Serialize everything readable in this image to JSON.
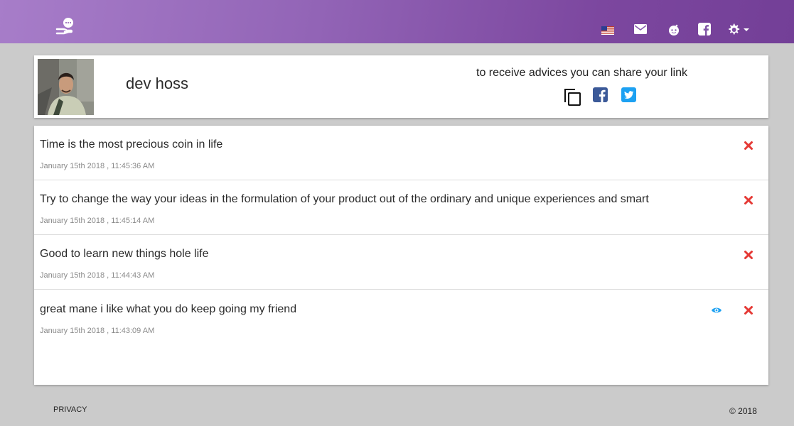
{
  "nav": {
    "icons": [
      "hand-chat-logo-icon",
      "us-flag-icon",
      "mail-icon",
      "reddit-icon",
      "facebook-icon",
      "gear-icon",
      "caret-down-icon"
    ],
    "gradient": [
      "#a77dc9",
      "#733f97"
    ]
  },
  "profile": {
    "name": "dev hoss",
    "share_text": "to receive advices you can share your link",
    "share_icons": [
      "copy-icon",
      "facebook-icon",
      "twitter-icon"
    ]
  },
  "messages": [
    {
      "text": "Time is the most precious coin in life",
      "date": "January 15th 2018 , 11:45:36 AM",
      "viewed": false
    },
    {
      "text": "Try to change the way your ideas in the formulation of your product out of the ordinary and unique experiences and smart",
      "date": "January 15th 2018 , 11:45:14 AM",
      "viewed": false
    },
    {
      "text": "Good to learn new things hole life",
      "date": "January 15th 2018 , 11:44:43 AM",
      "viewed": false
    },
    {
      "text": "great mane i like what you do keep going my friend",
      "date": "January 15th 2018 , 11:43:09 AM",
      "viewed": true
    }
  ],
  "footer": {
    "privacy": "PRIVACY",
    "copyright": "© 2018"
  },
  "colors": {
    "delete": "#e53935",
    "eye": "#1da1f2",
    "facebook": "#3b5998",
    "twitter": "#1da1f2"
  }
}
